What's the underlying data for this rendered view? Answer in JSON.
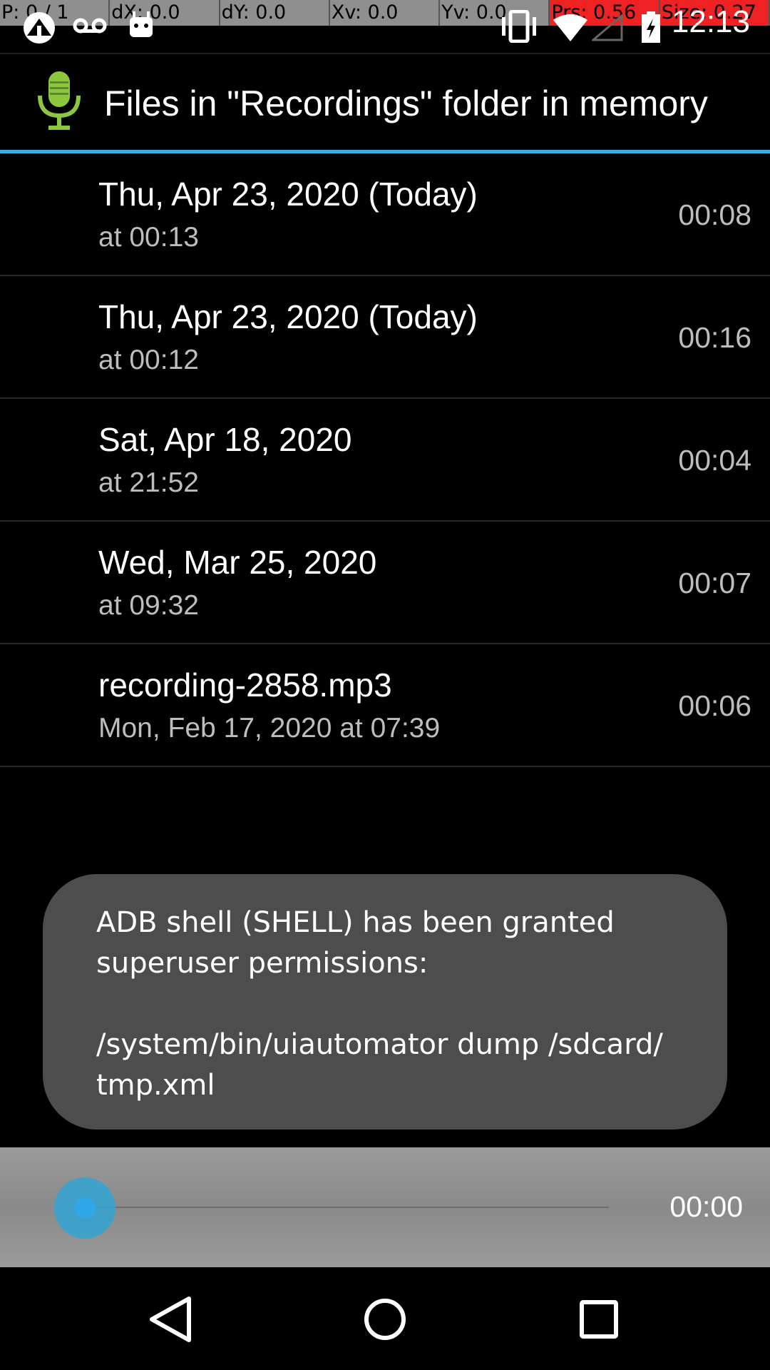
{
  "debug_overlay": {
    "cells": [
      "P: 0 / 1",
      "dX: 0.0",
      "dY: 0.0",
      "Xv: 0.0",
      "Yv: 0.0",
      "Prs: 0.56",
      "Size: 0.27"
    ]
  },
  "status_bar": {
    "time": "12:13",
    "icons": [
      "app-notification-icon",
      "voicemail-icon",
      "android-icon",
      "vibrate-icon",
      "wifi-icon",
      "signal-icon",
      "battery-charging-icon"
    ]
  },
  "app_bar": {
    "icon": "microphone-icon",
    "title": "Files in \"Recordings\" folder in memory"
  },
  "recordings": [
    {
      "primary": "Thu, Apr 23, 2020 (Today)",
      "secondary": "at 00:13",
      "duration": "00:08"
    },
    {
      "primary": "Thu, Apr 23, 2020 (Today)",
      "secondary": "at 00:12",
      "duration": "00:16"
    },
    {
      "primary": "Sat, Apr 18, 2020",
      "secondary": "at 21:52",
      "duration": "00:04"
    },
    {
      "primary": "Wed, Mar 25, 2020",
      "secondary": "at 09:32",
      "duration": "00:07"
    },
    {
      "primary": "recording-2858.mp3",
      "secondary": "Mon, Feb 17, 2020 at 07:39",
      "duration": "00:06"
    }
  ],
  "toast": {
    "line1": "ADB shell (SHELL) has been granted",
    "line2": "superuser permissions:",
    "line3": "/system/bin/uiautomator dump /sdcard/",
    "line4": "tmp.xml"
  },
  "player": {
    "time": "00:00",
    "progress": 0
  },
  "colors": {
    "accent": "#33b5e5",
    "toast_bg": "#4d4d4d",
    "player_bg": "#9b9b9b",
    "mic_green": "#8dc63f"
  },
  "nav": [
    "back-icon",
    "home-icon",
    "recents-icon"
  ]
}
